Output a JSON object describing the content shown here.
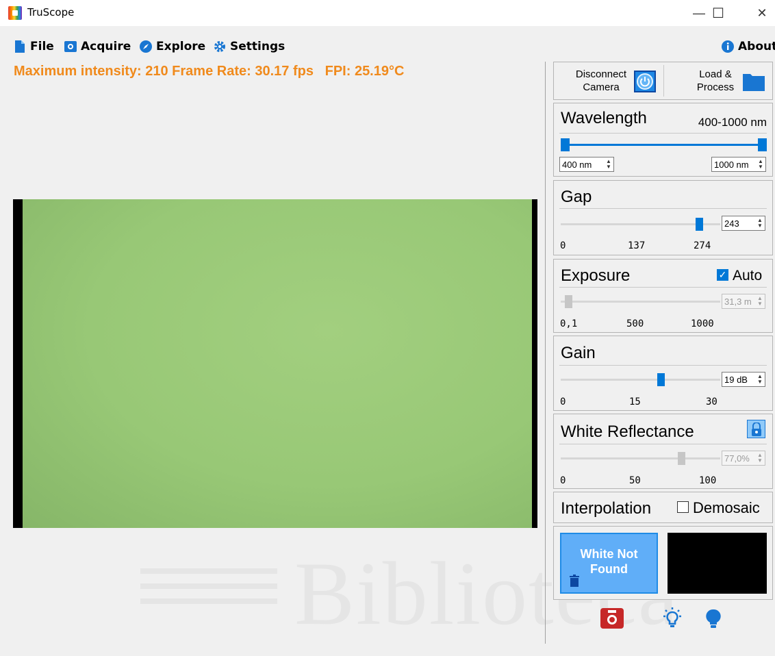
{
  "window": {
    "title": "TruScope",
    "minimize": "—",
    "maximize": "☐",
    "close": "✕"
  },
  "menu": {
    "file": "File",
    "acquire": "Acquire",
    "explore": "Explore",
    "settings": "Settings",
    "about": "About"
  },
  "status": {
    "text": "Maximum intensity: 210 Frame Rate: 30.17 fps   FPI: 25.19°C"
  },
  "top_buttons": {
    "disconnect_line1": "Disconnect",
    "disconnect_line2": "Camera",
    "load_line1": "Load &",
    "load_line2": "Process"
  },
  "wavelength": {
    "title": "Wavelength",
    "range": "400-1000 nm",
    "min_value": "400 nm",
    "max_value": "1000 nm",
    "min_level": 0,
    "max_level": 1
  },
  "gap": {
    "title": "Gap",
    "value": "243",
    "level": 0.887,
    "ticks": [
      "0",
      "137",
      "274"
    ]
  },
  "exposure": {
    "title": "Exposure",
    "auto_label": "Auto",
    "auto_checked": true,
    "value": "31,3 m",
    "ticks": [
      "0,1",
      "500",
      "1000"
    ]
  },
  "gain": {
    "title": "Gain",
    "value": "19 dB",
    "level": 0.633,
    "ticks": [
      "0",
      "15",
      "30"
    ]
  },
  "white_reflectance": {
    "title": "White Reflectance",
    "value": "77,0%",
    "level": 0.77,
    "ticks": [
      "0",
      "50",
      "100"
    ]
  },
  "interpolation": {
    "title": "Interpolation",
    "demosaic_label": "Demosaic",
    "demosaic_checked": false
  },
  "white_status": {
    "line1": "White Not",
    "line2": "Found"
  },
  "watermark": "Biblioteca",
  "colors": {
    "accent": "#0078d7",
    "status_orange": "#f08a1c",
    "white_button": "#60aef8",
    "camera_red": "#c62828"
  }
}
